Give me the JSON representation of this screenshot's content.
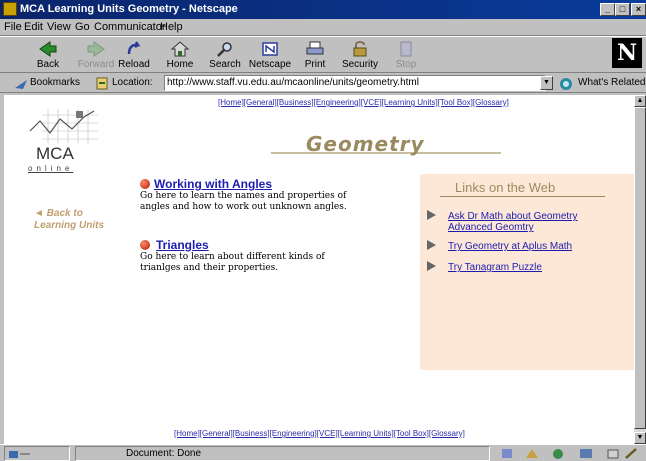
{
  "window": {
    "title": "MCA Learning Units Geometry - Netscape",
    "controls": [
      "_",
      "□",
      "×"
    ]
  },
  "menu": [
    "File",
    "Edit",
    "View",
    "Go",
    "Communicator",
    "Help"
  ],
  "toolbar": {
    "back": "Back",
    "forward": "Forward",
    "reload": "Reload",
    "home": "Home",
    "search": "Search",
    "netscape": "Netscape",
    "print": "Print",
    "security": "Security",
    "stop": "Stop",
    "logo": "N"
  },
  "location": {
    "bookmarks": "Bookmarks",
    "label": "Location:",
    "url": "http://www.staff.vu.edu.au/mcaonline/units/geometry.html",
    "whats_related": "What's Related"
  },
  "page": {
    "top_nav": [
      "[Home]",
      "[General]",
      "[Business]",
      "[Engineering]",
      "[VCE]",
      "[Learning Units]",
      "[Tool Box]",
      "[Glossary]"
    ],
    "bottom_nav": [
      "[Home]",
      "[General]",
      "[Business]",
      "[Engineering]",
      "[VCE]",
      "[Learning Units]",
      "[Tool Box]",
      "[Glossary]"
    ],
    "logo_text": "MCA",
    "logo_sub": "online",
    "title": "Geometry",
    "back_link": [
      "◄ Back to",
      "Learning Units"
    ],
    "topics": [
      {
        "title": "Working with Angles",
        "desc": "Go here to learn the names and properties of angles and how to work out unknown angles."
      },
      {
        "title": "Triangles",
        "desc": "Go here to learn about different kinds of trianlges and their properties."
      }
    ],
    "links_panel": {
      "heading": "Links on the Web",
      "links": [
        [
          "Ask Dr Math about Geometry",
          "Advanced Geomtry"
        ],
        [
          "Try Geometry at Aplus Math"
        ],
        [
          "Try Tanagram Puzzle"
        ]
      ]
    }
  },
  "status": {
    "text": "Document: Done"
  }
}
